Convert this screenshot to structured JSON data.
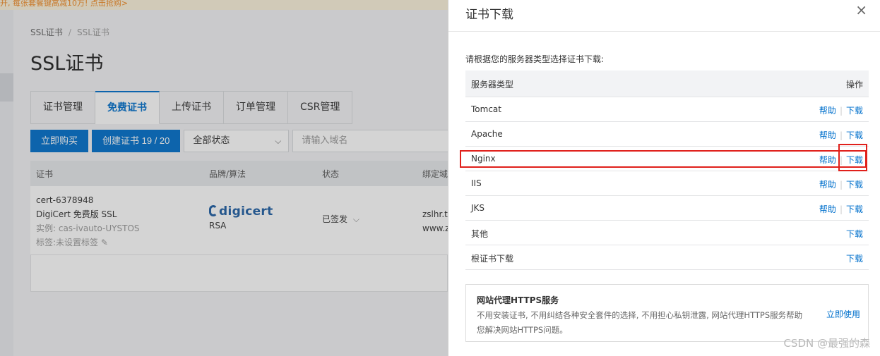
{
  "promo_banner": "开, 每张套餐键高减10万! 点击抢购>",
  "breadcrumb": {
    "item1": "SSL证书",
    "sep": "/",
    "item2": "SSL证书"
  },
  "page_title": "SSL证书",
  "tabs": [
    {
      "label": "证书管理"
    },
    {
      "label": "免费证书"
    },
    {
      "label": "上传证书"
    },
    {
      "label": "订单管理"
    },
    {
      "label": "CSR管理"
    }
  ],
  "toolbar": {
    "buy_label": "立即购买",
    "create_label": "创建证书 19 / 20",
    "status_filter": "全部状态",
    "search_placeholder": "请输入域名"
  },
  "cert_table": {
    "headers": [
      "证书",
      "品牌/算法",
      "状态",
      "绑定域"
    ],
    "row": {
      "cert_id": "cert-6378948",
      "cert_name": "DigiCert 免费版 SSL",
      "instance": "实例: cas-ivauto-UYSTOS",
      "tag": "标签:未设置标签",
      "brand_logo": "digicert",
      "algorithm": "RSA",
      "status": "已签发",
      "domain1": "zslhr.to",
      "domain2": "www.z"
    }
  },
  "drawer": {
    "title": "证书下载",
    "description": "请根据您的服务器类型选择证书下载:",
    "table_headers": {
      "type": "服务器类型",
      "operation": "操作"
    },
    "rows": [
      {
        "name": "Tomcat",
        "help": "帮助",
        "download": "下载"
      },
      {
        "name": "Apache",
        "help": "帮助",
        "download": "下载"
      },
      {
        "name": "Nginx",
        "help": "帮助",
        "download": "下载"
      },
      {
        "name": "IIS",
        "help": "帮助",
        "download": "下载"
      },
      {
        "name": "JKS",
        "help": "帮助",
        "download": "下载"
      },
      {
        "name": "其他",
        "download": "下载"
      },
      {
        "name": "根证书下载",
        "download": "下载"
      }
    ],
    "proxy_box": {
      "title": "网站代理HTTPS服务",
      "text": "不用安装证书, 不用纠结各种安全套件的选择, 不用担心私钥泄露, 网站代理HTTPS服务帮助您解决网站HTTPS问题。",
      "link": "立即使用"
    }
  },
  "watermark": "CSDN @最强的森",
  "colors": {
    "accent": "#0070cc",
    "highlight": "#e0201b",
    "promo": "#f08a24"
  }
}
